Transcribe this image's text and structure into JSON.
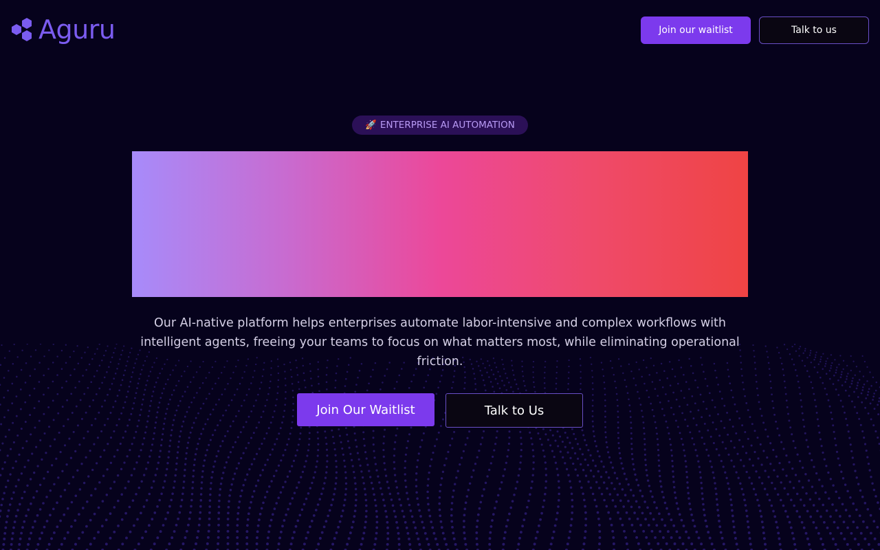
{
  "header": {
    "logo_text": "Aguru",
    "logo_icon": "hexagon-cluster-icon",
    "waitlist_label": "Join our waitlist",
    "talk_label": "Talk to us"
  },
  "hero": {
    "badge_icon": "🚀",
    "badge_text": "ENTERPRISE AI AUTOMATION",
    "description": "Our AI-native platform helps enterprises automate labor-intensive and complex workflows with intelligent agents, freeing your teams to focus on what matters most, while eliminating operational friction.",
    "cta_primary": "Join Our Waitlist",
    "cta_secondary": "Talk to Us"
  },
  "colors": {
    "background": "#06021c",
    "accent": "#7c3aed",
    "logo": "#7b5cf0",
    "badge_bg": "#2b1057",
    "badge_text": "#b89af5",
    "gradient_start": "#a78bfa",
    "gradient_mid": "#ec4899",
    "gradient_end": "#ef4444",
    "wave_dots": "#2a1a6e"
  }
}
